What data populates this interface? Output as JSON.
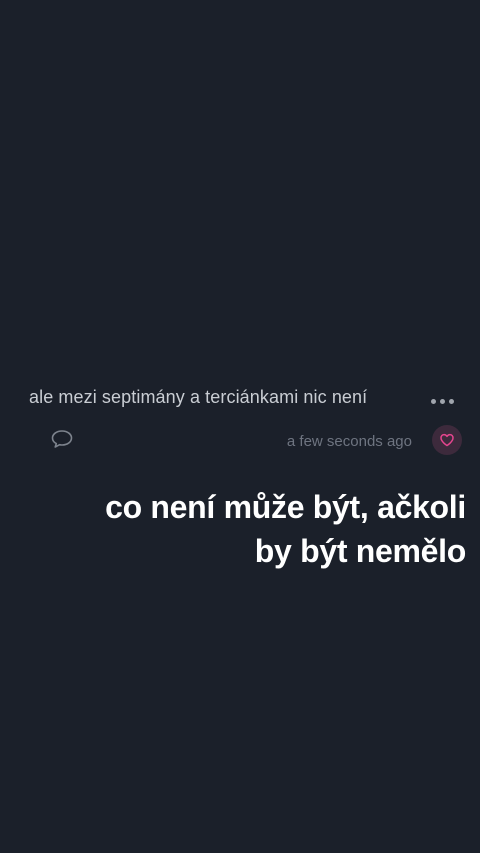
{
  "post": {
    "text": "ale mezi septimány a terciánkami nic není",
    "timestamp": "a few seconds ago",
    "icons": {
      "more": "more-horizontal-icon",
      "comment": "speech-bubble-icon",
      "like": "heart-icon"
    },
    "colors": {
      "background": "#1b202a",
      "accent": "#e5458e"
    }
  },
  "reply": {
    "line1": "co není může být, ačkoli",
    "line2": "by být nemělo"
  }
}
